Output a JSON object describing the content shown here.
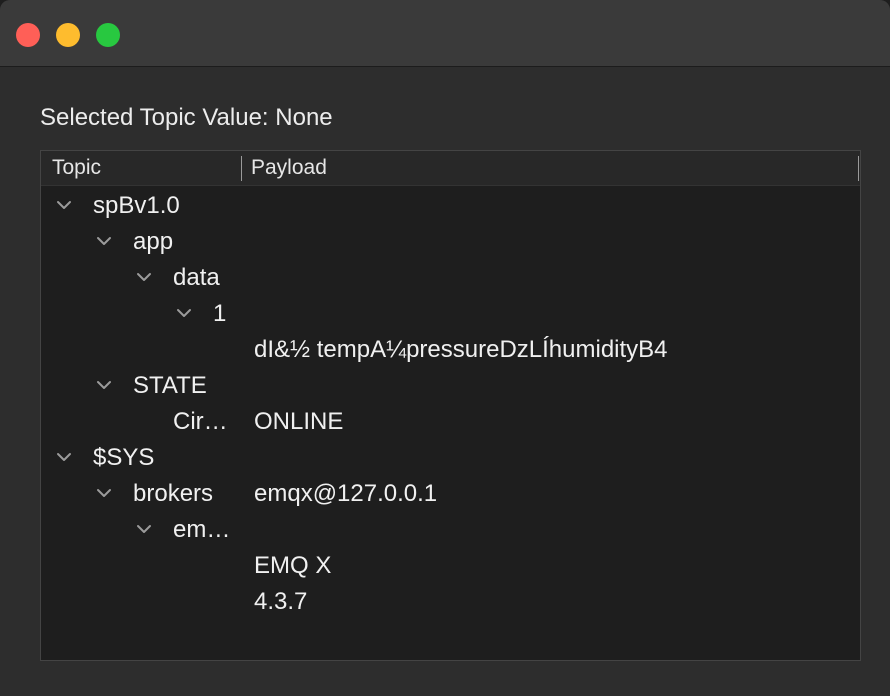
{
  "window": {
    "traffic_lights": {
      "close_color": "#ff5f57",
      "minimize_color": "#febc2e",
      "zoom_color": "#28c840"
    }
  },
  "selected_topic": {
    "label": "Selected Topic Value: None"
  },
  "tree": {
    "columns": [
      "Topic",
      "Payload"
    ],
    "rows": [
      {
        "topic": "spBv1.0",
        "payload": "",
        "depth": 0,
        "expanded": true
      },
      {
        "topic": "app",
        "payload": "",
        "depth": 1,
        "expanded": true
      },
      {
        "topic": "data",
        "payload": "",
        "depth": 2,
        "expanded": true
      },
      {
        "topic": "1",
        "payload": "",
        "depth": 3,
        "expanded": true
      },
      {
        "topic": "",
        "payload": "dI&½  tempA¼pressureDzLÍhumidityB4",
        "depth": 4,
        "expanded": false
      },
      {
        "topic": "STATE",
        "payload": "",
        "depth": 1,
        "expanded": true
      },
      {
        "topic": "Cir…",
        "payload": "ONLINE",
        "depth": 2,
        "expanded": false
      },
      {
        "topic": "$SYS",
        "payload": "",
        "depth": 0,
        "expanded": true
      },
      {
        "topic": "brokers",
        "payload": "emqx@127.0.0.1",
        "depth": 1,
        "expanded": true
      },
      {
        "topic": "em…",
        "payload": "",
        "depth": 2,
        "expanded": true
      },
      {
        "topic": "",
        "payload": "EMQ X",
        "depth": 3,
        "expanded": false
      },
      {
        "topic": "",
        "payload": "4.3.7",
        "depth": 3,
        "expanded": false
      }
    ]
  }
}
